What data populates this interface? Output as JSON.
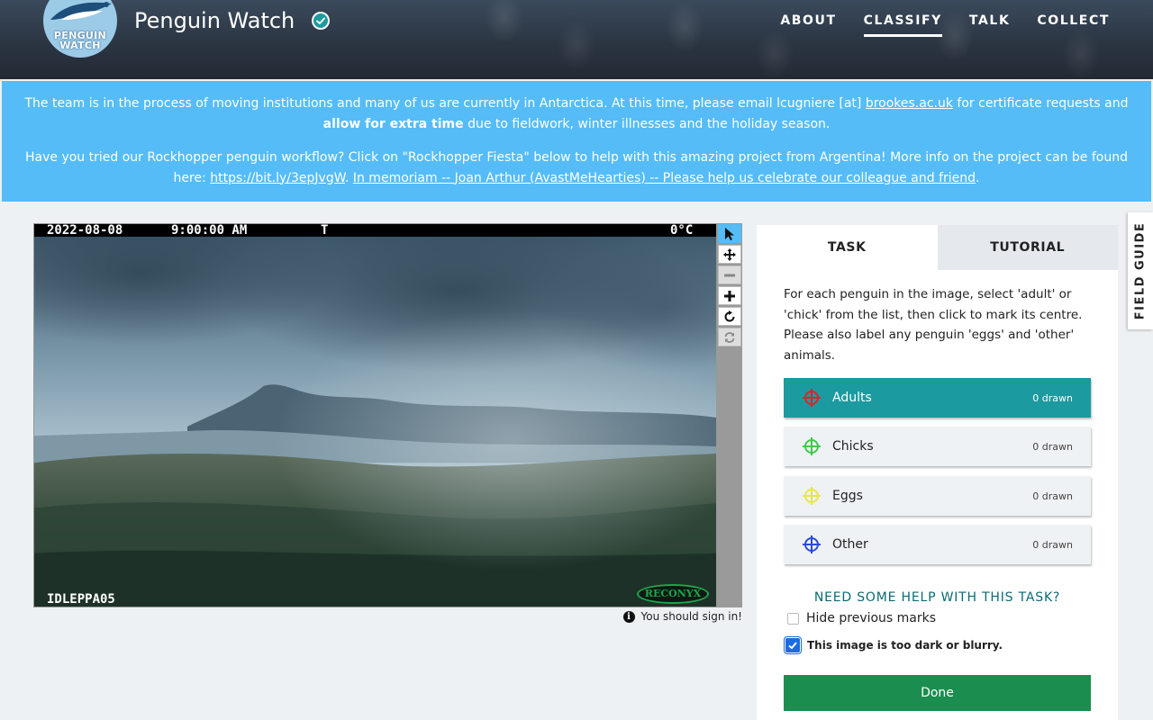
{
  "header": {
    "logo_line1": "PENGUIN",
    "logo_line2": "WATCH",
    "project_title": "Penguin Watch",
    "nav": {
      "about": "ABOUT",
      "classify": "CLASSIFY",
      "talk": "TALK",
      "collect": "COLLECT"
    }
  },
  "announcement": {
    "p1_text_1": "The team is in the process of moving institutions and many of us are currently in Antarctica. At this time, please email lcugniere [at] ",
    "p1_link": "brookes.ac.uk",
    "p1_text_2": " for certificate requests and ",
    "p1_bold": "allow for extra time",
    "p1_text_3": " due to fieldwork, winter illnesses and the holiday season.",
    "p2_text_1": "Have you tried our Rockhopper penguin workflow? Click on \"Rockhopper Fiesta\" below to help with this amazing project from Argentina! More info on the project can be found here: ",
    "p2_link1": "https://bit.ly/3epJvgW",
    "p2_sep": ". ",
    "p2_link2": "In memoriam -- Joan Arthur (AvastMeHearties) -- Please help us celebrate our colleague and friend",
    "p2_end": "."
  },
  "subject": {
    "date": "2022-08-08",
    "time": "9:00:00 AM",
    "flag": "T",
    "temperature": "0°C",
    "camera_id": "IDLEPPA05",
    "camera_brand": "RECONYX"
  },
  "signin_notice": "You should sign in!",
  "task_panel": {
    "tabs": {
      "task": "TASK",
      "tutorial": "TUTORIAL"
    },
    "instructions": "For each penguin in the image, select 'adult' or 'chick' from the list, then click to mark its centre. Please also label any penguin 'eggs' and 'other' animals.",
    "tools": [
      {
        "label": "Adults",
        "count": "0 drawn",
        "color": "#d9252b"
      },
      {
        "label": "Chicks",
        "count": "0 drawn",
        "color": "#3fc94b"
      },
      {
        "label": "Eggs",
        "count": "0 drawn",
        "color": "#e6e64a"
      },
      {
        "label": "Other",
        "count": "0 drawn",
        "color": "#2b4bd6"
      }
    ],
    "help_link": "NEED SOME HELP WITH THIS TASK?",
    "hide_marks_label": "Hide previous marks",
    "hide_marks_checked": false,
    "too_dark_label": "This image is too dark or blurry.",
    "too_dark_checked": true,
    "done_label": "Done"
  },
  "field_guide": "FIELD GUIDE",
  "colors": {
    "banner": "#55bcf7",
    "active_tool": "#1b9aa0",
    "done": "#1b8e4f",
    "help_link": "#0b6a73",
    "toolbar_active": "#55bcf7"
  }
}
